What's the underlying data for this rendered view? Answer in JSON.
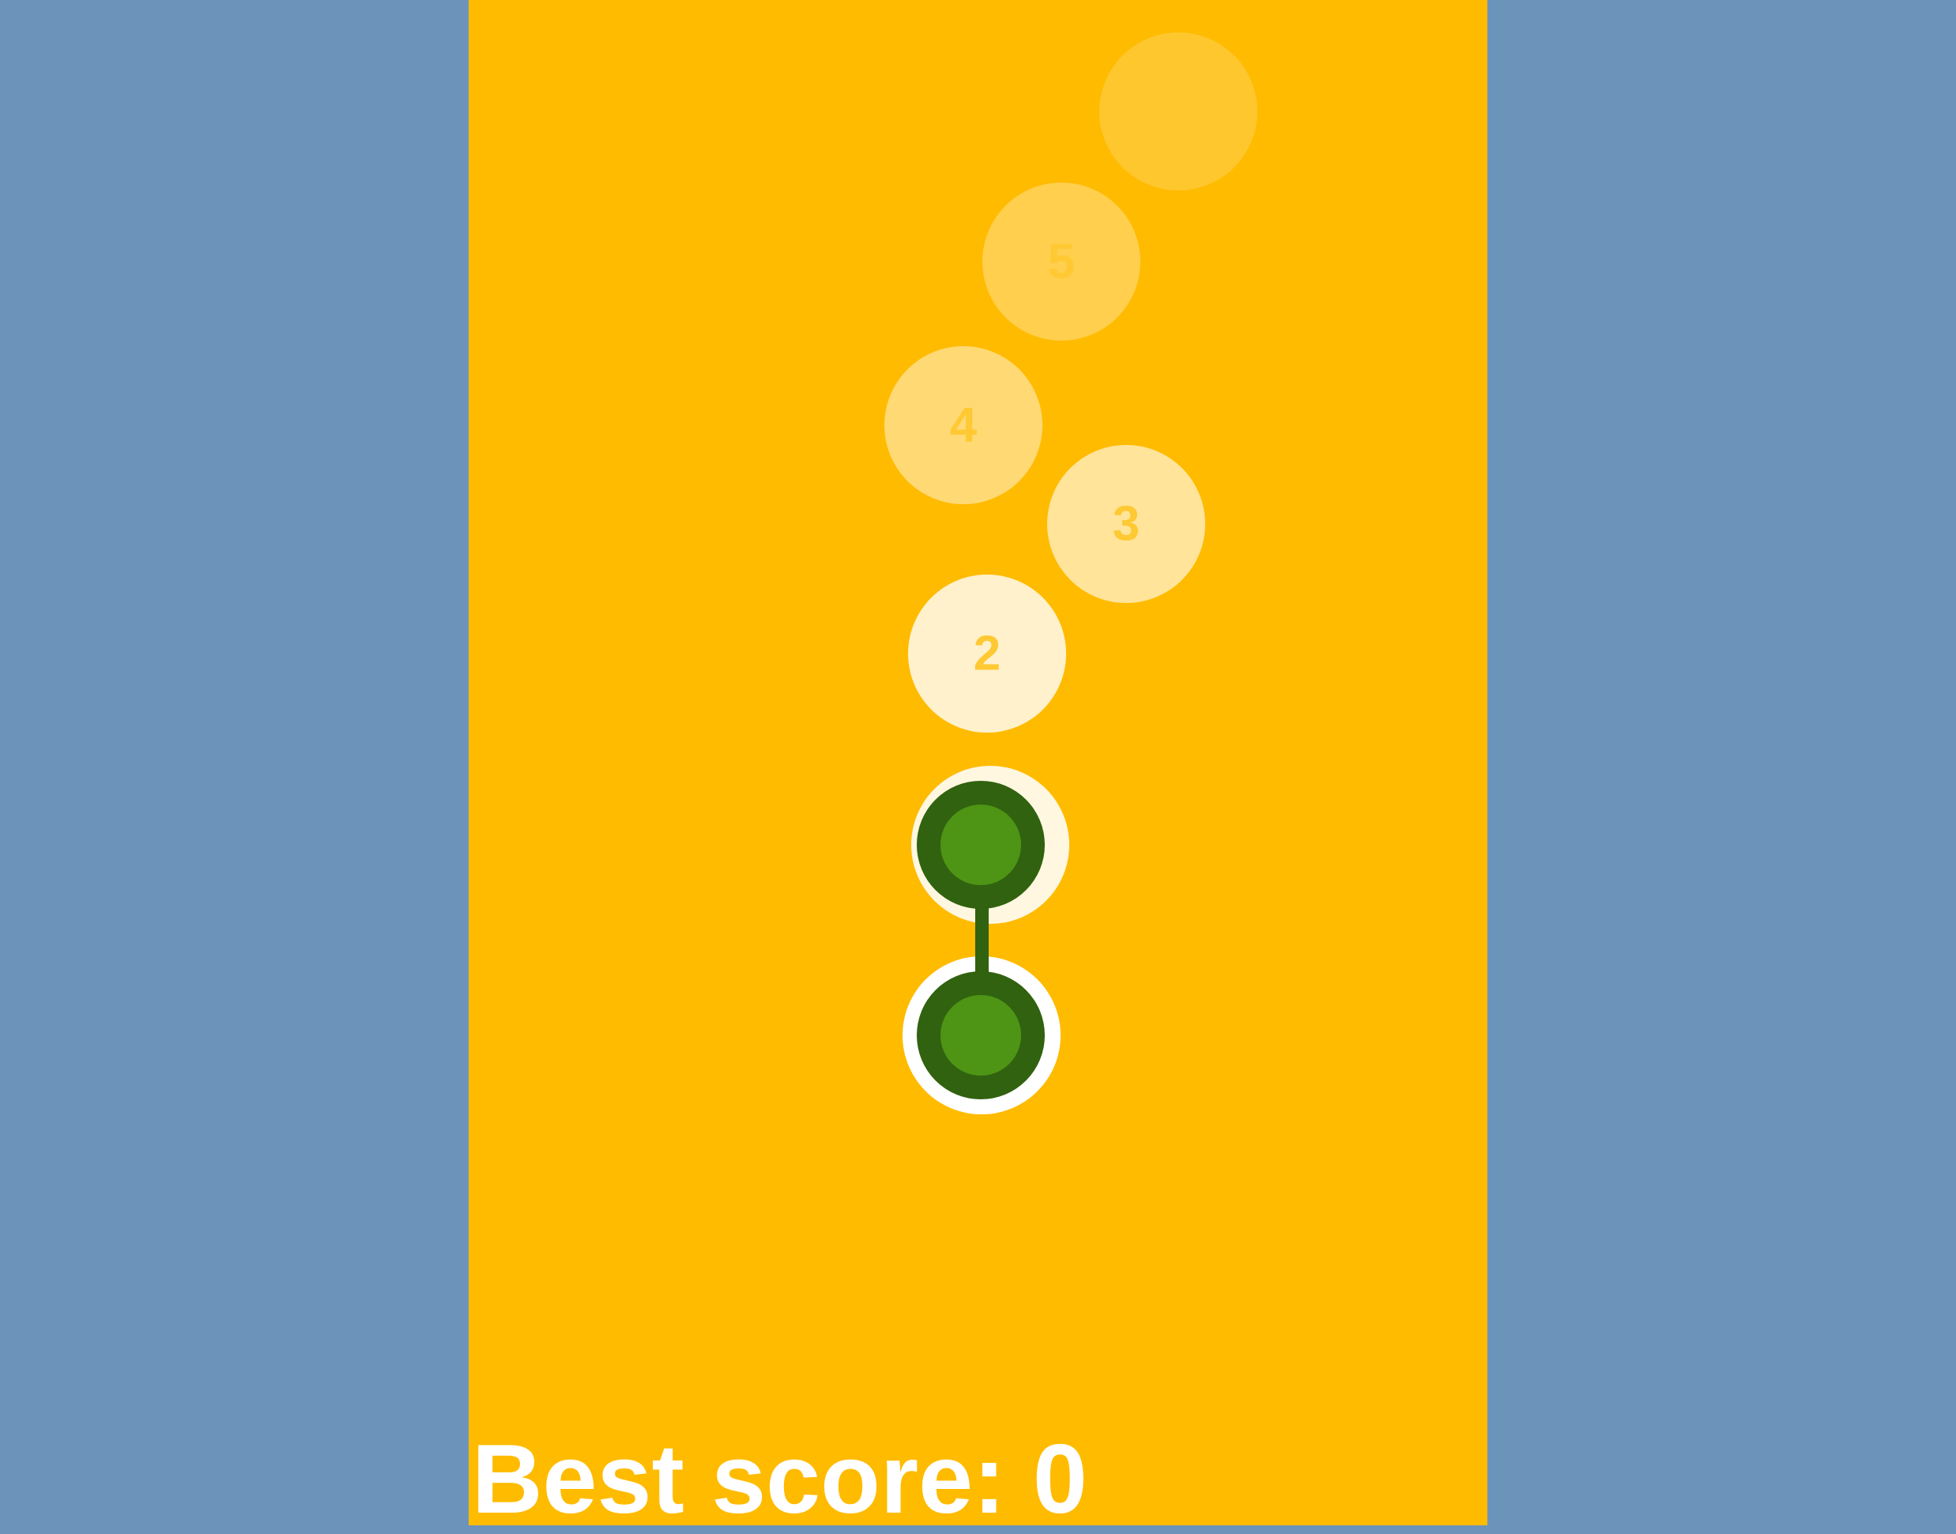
{
  "game": {
    "best_score_label": "Best score: 0",
    "colors": {
      "side_background": "#6c94bb",
      "playfield": "#ffbb00",
      "target_number": "#ffc933",
      "player_ring": "#ffffff",
      "player_outer": "#31620f",
      "player_inner": "#4e9516",
      "connector": "#31620f"
    },
    "targets": [
      {
        "label": "2",
        "opacity": 0.8
      },
      {
        "label": "3",
        "opacity": 0.6
      },
      {
        "label": "4",
        "opacity": 0.45
      },
      {
        "label": "5",
        "opacity": 0.3
      },
      {
        "label": "",
        "opacity": 0.18
      }
    ],
    "player": {
      "name": "dumbbell",
      "balls": 2
    }
  }
}
